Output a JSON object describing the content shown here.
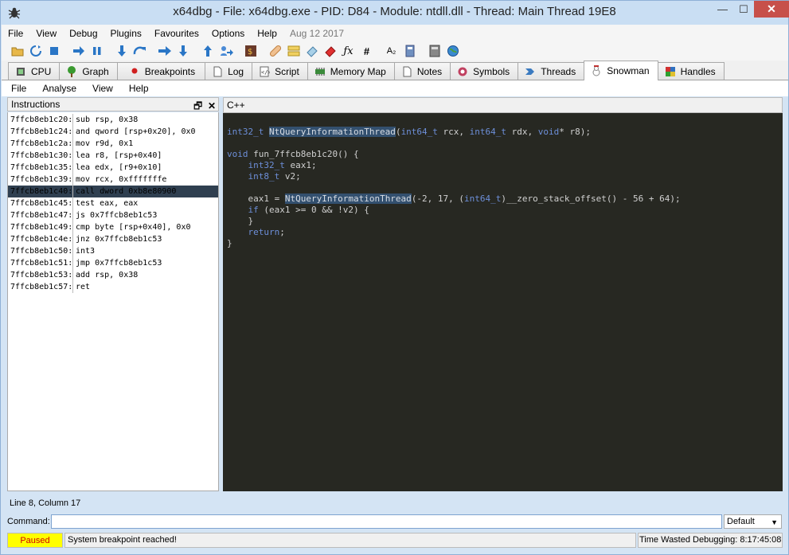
{
  "window": {
    "title": "x64dbg - File: x64dbg.exe - PID: D84 - Module: ntdll.dll - Thread: Main Thread 19E8",
    "minimize": "—",
    "maximize": "☐",
    "close": "✕"
  },
  "menu": {
    "items": [
      "File",
      "View",
      "Debug",
      "Plugins",
      "Favourites",
      "Options",
      "Help"
    ],
    "date": "Aug 12 2017"
  },
  "toolbar": {
    "icons": [
      "open-icon",
      "restart-icon",
      "stop-icon",
      "run-icon",
      "pause-icon",
      "step-into-icon",
      "step-over-icon",
      "trace-into-icon",
      "trace-over-icon",
      "execute-till-return-icon",
      "run-to-user-code-icon",
      "scylla-icon",
      "patch-icon",
      "comments-icon",
      "labels-icon",
      "bookmarks-icon",
      "functions-icon",
      "variables-icon",
      "strings-icon",
      "modules-icon",
      "calculator-icon",
      "web-icon"
    ]
  },
  "tabs": [
    {
      "label": "CPU",
      "icon": "cpu-icon"
    },
    {
      "label": "Graph",
      "icon": "graph-icon"
    },
    {
      "label": "Breakpoints",
      "icon": "breakpoint-icon"
    },
    {
      "label": "Log",
      "icon": "log-icon"
    },
    {
      "label": "Script",
      "icon": "script-icon"
    },
    {
      "label": "Memory Map",
      "icon": "memory-map-icon"
    },
    {
      "label": "Notes",
      "icon": "notes-icon"
    },
    {
      "label": "Symbols",
      "icon": "symbols-icon"
    },
    {
      "label": "Threads",
      "icon": "threads-icon"
    },
    {
      "label": "Snowman",
      "icon": "snowman-icon"
    },
    {
      "label": "Handles",
      "icon": "handles-icon"
    }
  ],
  "snowman_menu": {
    "items": [
      "File",
      "Analyse",
      "View",
      "Help"
    ]
  },
  "instructions": {
    "title": "Instructions",
    "rows": [
      {
        "addr": "7ffcb8eb1c20:",
        "text": "sub rsp, 0x38"
      },
      {
        "addr": "7ffcb8eb1c24:",
        "text": "and qword [rsp+0x20], 0x0"
      },
      {
        "addr": "7ffcb8eb1c2a:",
        "text": "mov r9d, 0x1"
      },
      {
        "addr": "7ffcb8eb1c30:",
        "text": "lea r8, [rsp+0x40]"
      },
      {
        "addr": "7ffcb8eb1c35:",
        "text": "lea edx, [r9+0x10]"
      },
      {
        "addr": "7ffcb8eb1c39:",
        "text": "mov rcx, 0xfffffffe"
      },
      {
        "addr": "7ffcb8eb1c40:",
        "text": "call dword 0xb8e80900"
      },
      {
        "addr": "7ffcb8eb1c45:",
        "text": "test eax, eax"
      },
      {
        "addr": "7ffcb8eb1c47:",
        "text": "js 0x7ffcb8eb1c53"
      },
      {
        "addr": "7ffcb8eb1c49:",
        "text": "cmp byte [rsp+0x40], 0x0"
      },
      {
        "addr": "7ffcb8eb1c4e:",
        "text": "jnz 0x7ffcb8eb1c53"
      },
      {
        "addr": "7ffcb8eb1c50:",
        "text": "int3"
      },
      {
        "addr": "7ffcb8eb1c51:",
        "text": "jmp 0x7ffcb8eb1c53"
      },
      {
        "addr": "7ffcb8eb1c53:",
        "text": "add rsp, 0x38"
      },
      {
        "addr": "7ffcb8eb1c57:",
        "text": "ret"
      }
    ]
  },
  "code": {
    "title": "C++",
    "lines": [
      [
        {
          "t": "int32_t",
          "k": 1
        },
        {
          "t": " "
        },
        {
          "t": "NtQueryInformationThread",
          "h": 1
        },
        {
          "t": "("
        },
        {
          "t": "int64_t",
          "k": 1
        },
        {
          "t": " rcx, "
        },
        {
          "t": "int64_t",
          "k": 1
        },
        {
          "t": " rdx, "
        },
        {
          "t": "void",
          "k": 1
        },
        {
          "t": "* r8);"
        }
      ],
      [
        {
          "t": ""
        }
      ],
      [
        {
          "t": "void",
          "k": 1
        },
        {
          "t": " fun_7ffcb8eb1c20() {"
        }
      ],
      [
        {
          "t": "    "
        },
        {
          "t": "int32_t",
          "k": 1
        },
        {
          "t": " eax1;"
        }
      ],
      [
        {
          "t": "    "
        },
        {
          "t": "int8_t",
          "k": 1
        },
        {
          "t": " v2;"
        }
      ],
      [
        {
          "t": ""
        }
      ],
      [
        {
          "t": "    eax1 = "
        },
        {
          "t": "NtQueryInformationThread",
          "h": 1
        },
        {
          "t": "(-2, 17, ("
        },
        {
          "t": "int64_t",
          "k": 1
        },
        {
          "t": ")__zero_stack_offset() - 56 + 64);"
        }
      ],
      [
        {
          "t": "    "
        },
        {
          "t": "if",
          "k": 1
        },
        {
          "t": " (eax1 >= 0 && !v2) {"
        }
      ],
      [
        {
          "t": "    }"
        }
      ],
      [
        {
          "t": "    "
        },
        {
          "t": "return",
          "k": 1
        },
        {
          "t": ";"
        }
      ],
      [
        {
          "t": "}"
        }
      ]
    ]
  },
  "status": {
    "position": "Line 8, Column 17"
  },
  "command": {
    "label": "Command:",
    "value": "",
    "mode": "Default"
  },
  "bottom": {
    "state": "Paused",
    "message": "System breakpoint reached!",
    "time": "Time Wasted Debugging: 8:17:45:08"
  }
}
